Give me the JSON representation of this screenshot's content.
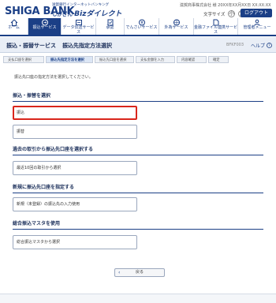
{
  "header": {
    "logo": "SHIGA BANK",
    "tagline_top": "滋賀銀行インターネットバンキング",
    "tagline_prefix": "しがぎん",
    "tagline_biz": "Bizダイレクト",
    "user_info": "滋賀商事株式会社 様 20XX年XX月XX日 XX:XX:XX",
    "font_size_label": "文字サイズ",
    "font_small": "小",
    "font_large": "大",
    "logout_label": "ログアウト",
    "brand_color": "#1b3f86"
  },
  "nav": [
    {
      "label": "ホーム",
      "icon": "home-icon"
    },
    {
      "label": "振込サービス",
      "icon": "transfer-icon",
      "active": true
    },
    {
      "label": "データ伝送サービス",
      "icon": "data-transfer-icon"
    },
    {
      "label": "承認",
      "icon": "approval-icon"
    },
    {
      "label": "でんさいサービス",
      "icon": "densai-icon"
    },
    {
      "label": "外為サービス",
      "icon": "forex-icon"
    },
    {
      "label": "金融ファイル連携サービス",
      "icon": "file-link-icon"
    },
    {
      "label": "管理者メニュー",
      "icon": "admin-icon"
    }
  ],
  "page": {
    "breadcrumb_parent": "振込・振替サービス",
    "title": "振込先指定方法選択",
    "screen_code": "BFKF003",
    "help_label": "ヘルプ"
  },
  "steps": [
    "支払口座を選択",
    "振込先指定方法を選択",
    "振込先口座を選択",
    "支払金額を入力",
    "内容確認",
    "確定"
  ],
  "instruction": "振込先口座の指定方法を選択してください。",
  "sections": [
    {
      "heading": "振込・振替を選択",
      "options": [
        "振込",
        "振替"
      ]
    },
    {
      "heading": "過去の取引から振込先口座を選択する",
      "options": [
        "最近10回の取引から選択"
      ]
    },
    {
      "heading": "新規に振込先口座を指定する",
      "options": [
        "新規（未登録）の振込先の入力使用"
      ]
    },
    {
      "heading": "総合振込マスタを使用",
      "options": [
        "総合振込マスタから選択"
      ]
    }
  ],
  "back_label": "戻る",
  "highlight_color": "#d9261c"
}
